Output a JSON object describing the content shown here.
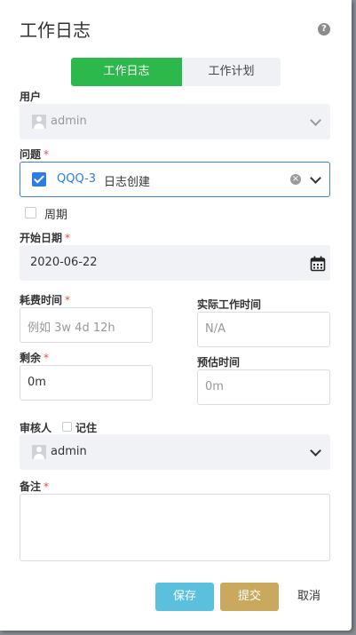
{
  "dialog": {
    "title": "工作日志",
    "help_icon": "?"
  },
  "tabs": [
    {
      "label": "工作日志",
      "active": true
    },
    {
      "label": "工作计划",
      "active": false
    }
  ],
  "user": {
    "label": "用户",
    "value": "admin"
  },
  "issue": {
    "label": "问题",
    "required": "*",
    "key": "QQQ-3",
    "summary": "日志创建",
    "checked": true
  },
  "period": {
    "label": "周期",
    "checked": false
  },
  "start_date": {
    "label": "开始日期",
    "required": "*",
    "value": "2020-06-22"
  },
  "time_spent": {
    "label": "耗费时间",
    "required": "*",
    "placeholder": "例如 3w 4d 12h"
  },
  "actual_time": {
    "label": "实际工作时间",
    "value": "N/A"
  },
  "remaining": {
    "label": "剩余",
    "required": "*",
    "value": "0m"
  },
  "estimate": {
    "label": "预估时间",
    "value": "0m"
  },
  "reviewer": {
    "label": "审核人",
    "remember_label": "记住",
    "value": "admin"
  },
  "note": {
    "label": "备注",
    "required": "*",
    "value": ""
  },
  "buttons": {
    "save": "保存",
    "submit": "提交",
    "cancel": "取消"
  },
  "colors": {
    "accent_green": "#2db84c",
    "primary_blue": "#3b84d6",
    "save_btn": "#5bc0de",
    "submit_btn": "#c8a95e",
    "required": "#e84c3d"
  }
}
